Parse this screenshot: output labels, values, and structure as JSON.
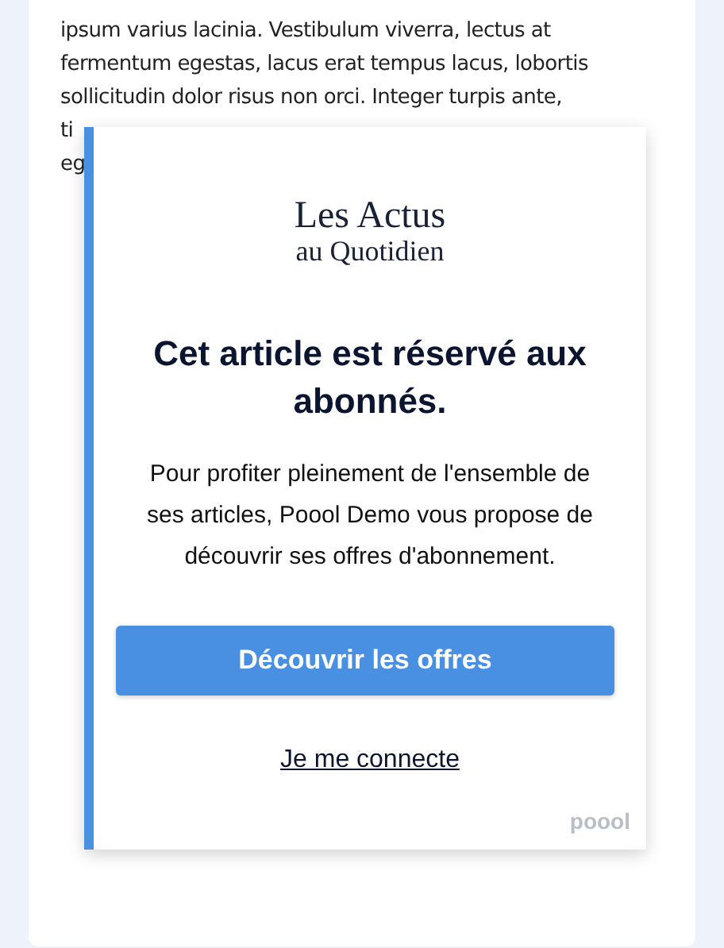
{
  "article": {
    "lines": [
      "ipsum varius lacinia. Vestibulum viverra, lectus at",
      "fermentum egestas, lacus erat tempus lacus, lobortis",
      "sollicitudin dolor risus non orci. Integer turpis ante,",
      "ti",
      "eg"
    ]
  },
  "paywall": {
    "logo": [
      "Les Actus",
      "au Quotidien"
    ],
    "title": "Cet article est réservé aux abonnés.",
    "text": "Pour profiter pleinement de l'ensemble de ses articles, Poool Demo vous propose de découvrir ses offres d'abonnement.",
    "button": "Découvrir les offres",
    "link": "Je me connecte",
    "brand": "poool"
  }
}
